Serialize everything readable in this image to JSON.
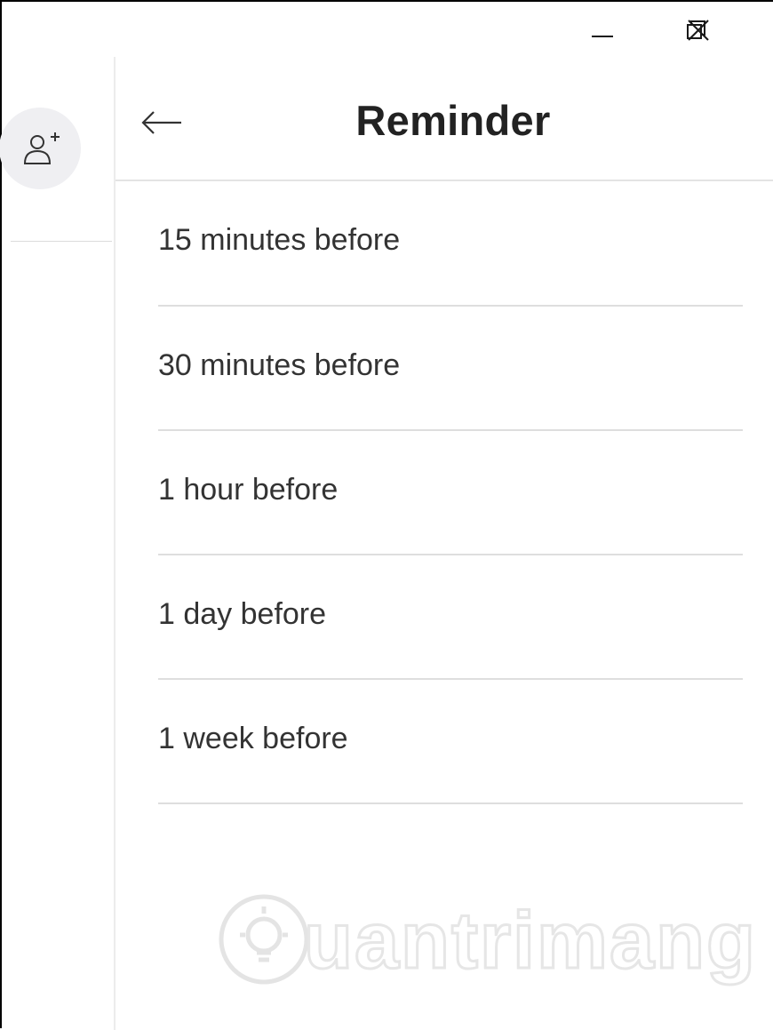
{
  "window_controls": {
    "minimize_icon": "minimize-icon",
    "restore_icon": "restore-icon",
    "close_icon": "close-icon"
  },
  "sidebar": {
    "add_contact_icon": "add-person-icon"
  },
  "panel": {
    "back_icon": "arrow-left-icon",
    "title": "Reminder"
  },
  "reminder_options": [
    {
      "label": "15 minutes before"
    },
    {
      "label": "30 minutes before"
    },
    {
      "label": "1 hour before"
    },
    {
      "label": "1 day before"
    },
    {
      "label": "1 week before"
    }
  ],
  "watermark": {
    "text": "uantrimang",
    "logo_icon": "lightbulb-icon"
  }
}
